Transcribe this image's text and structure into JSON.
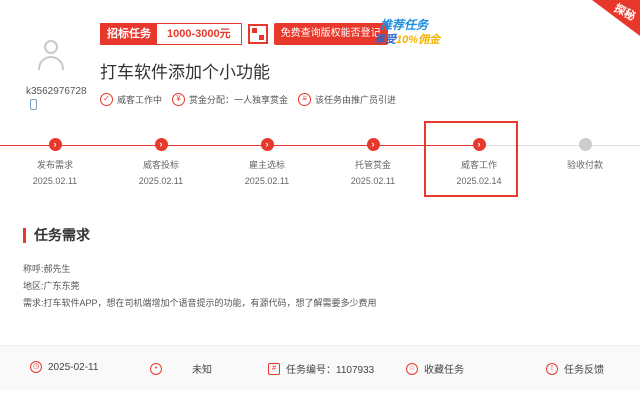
{
  "user": {
    "name": "k3562976728"
  },
  "tags": {
    "type_label": "招标任务",
    "price": "1000-3000元",
    "check_button": "免费查询版权能否登记"
  },
  "promo": {
    "line1": "推荐任务",
    "line2_a": "享受",
    "line2_b": "10%佣金"
  },
  "ribbon": {
    "text": "探秘"
  },
  "task": {
    "title": "打车软件添加个小功能",
    "status": [
      {
        "icon": "check-circle-icon",
        "text": "威客工作中"
      },
      {
        "icon": "yen-circle-icon",
        "text": "赏金分配：一人独享赏金"
      },
      {
        "icon": "person-pin-icon",
        "text": "该任务由推广员引进"
      }
    ]
  },
  "steps": [
    {
      "label": "发布需求",
      "date": "2025.02.11",
      "done": true
    },
    {
      "label": "威客投标",
      "date": "2025.02.11",
      "done": true
    },
    {
      "label": "雇主选标",
      "date": "2025.02.11",
      "done": true
    },
    {
      "label": "托管赏金",
      "date": "2025.02.11",
      "done": true
    },
    {
      "label": "威客工作",
      "date": "2025.02.14",
      "done": true
    },
    {
      "label": "验收付款",
      "date": "",
      "done": false
    }
  ],
  "requirements": {
    "title": "任务需求",
    "name_line": "称呼:郝先生",
    "region_line": "地区:广东东莞",
    "desc_line": "需求:打车软件APP，想在司机端增加个语音提示的功能，有源代码，想了解需要多少费用"
  },
  "footer": {
    "date": "2025-02-11",
    "location": "未知",
    "task_no": "任务编号：1107933",
    "collect": "收藏任务",
    "feedback": "任务反馈"
  },
  "colors": {
    "accent": "#e8382c",
    "promo_blue": "#1e8fe0",
    "promo_gold": "#f5b400"
  }
}
